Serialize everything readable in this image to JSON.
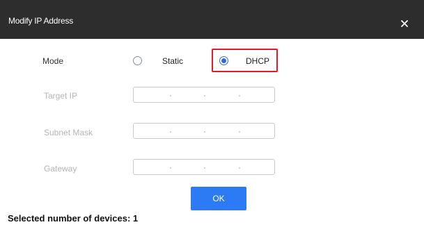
{
  "dialog": {
    "title": "Modify IP Address"
  },
  "mode": {
    "label": "Mode",
    "options": [
      {
        "label": "Static",
        "selected": false
      },
      {
        "label": "DHCP",
        "selected": true
      }
    ]
  },
  "fields": [
    {
      "label": "Target IP",
      "enabled": false
    },
    {
      "label": "Subnet Mask",
      "enabled": false
    },
    {
      "label": "Gateway",
      "enabled": false
    }
  ],
  "buttons": {
    "ok_label": "OK"
  },
  "footer": {
    "selected_devices_text": "Selected number of devices: 1"
  },
  "colors": {
    "titlebar": "#2d2d2d",
    "accent": "#2d7bf4",
    "highlight": "#e01b24"
  }
}
